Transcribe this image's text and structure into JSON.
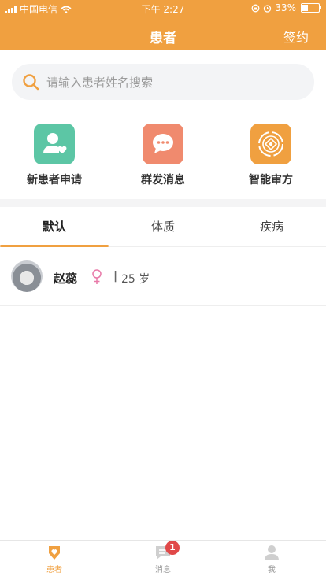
{
  "status_bar": {
    "carrier": "中国电信",
    "time": "下午 2:27",
    "battery": "33%"
  },
  "header": {
    "title": "患者",
    "action": "签约"
  },
  "search": {
    "placeholder": "请输入患者姓名搜索"
  },
  "quick_actions": [
    {
      "label": "新患者申请",
      "icon": "person-heart-icon",
      "color": "#5cc6a5"
    },
    {
      "label": "群发消息",
      "icon": "chat-bubble-icon",
      "color": "#f08a6e"
    },
    {
      "label": "智能审方",
      "icon": "smart-review-icon",
      "color": "#f0a040"
    }
  ],
  "tabs": [
    {
      "label": "默认"
    },
    {
      "label": "体质"
    },
    {
      "label": "疾病"
    }
  ],
  "patients": [
    {
      "name": "赵蕊",
      "gender": "female",
      "age": "25 岁"
    }
  ],
  "tab_bar": [
    {
      "label": "患者",
      "icon": "patient-heart-icon"
    },
    {
      "label": "消息",
      "icon": "message-icon",
      "badge": "1"
    },
    {
      "label": "我",
      "icon": "profile-icon"
    }
  ],
  "colors": {
    "accent": "#f0a040",
    "female": "#e879a8"
  }
}
